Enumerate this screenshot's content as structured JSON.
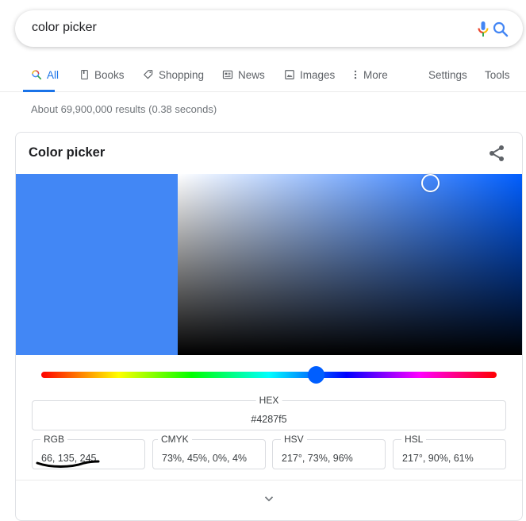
{
  "search": {
    "query": "color picker",
    "mic_icon": "microphone-icon",
    "search_icon": "search-icon"
  },
  "tabs": [
    {
      "label": "All",
      "icon": "search-icon",
      "active": true
    },
    {
      "label": "Books",
      "icon": "book-icon"
    },
    {
      "label": "Shopping",
      "icon": "tag-icon"
    },
    {
      "label": "News",
      "icon": "newspaper-icon"
    },
    {
      "label": "Images",
      "icon": "image-icon"
    },
    {
      "label": "More",
      "icon": "more-vert-icon"
    },
    {
      "label": "Settings"
    },
    {
      "label": "Tools"
    }
  ],
  "results_stats": "About 69,900,000 results (0.38 seconds)",
  "card": {
    "title": "Color picker",
    "share_icon": "share-icon",
    "selected_color": "#4287f5",
    "hue_color": "#005eff",
    "hue_degrees": 217,
    "saturation_percent": 73,
    "value_percent": 96,
    "fields": {
      "hex": {
        "label": "HEX",
        "value": "#4287f5"
      },
      "rgb": {
        "label": "RGB",
        "value": "66, 135, 245"
      },
      "cmyk": {
        "label": "CMYK",
        "value": "73%, 45%, 0%, 4%"
      },
      "hsv": {
        "label": "HSV",
        "value": "217°, 73%, 96%"
      },
      "hsl": {
        "label": "HSL",
        "value": "217°, 90%, 61%"
      }
    },
    "expand_icon": "chevron-down-icon"
  }
}
